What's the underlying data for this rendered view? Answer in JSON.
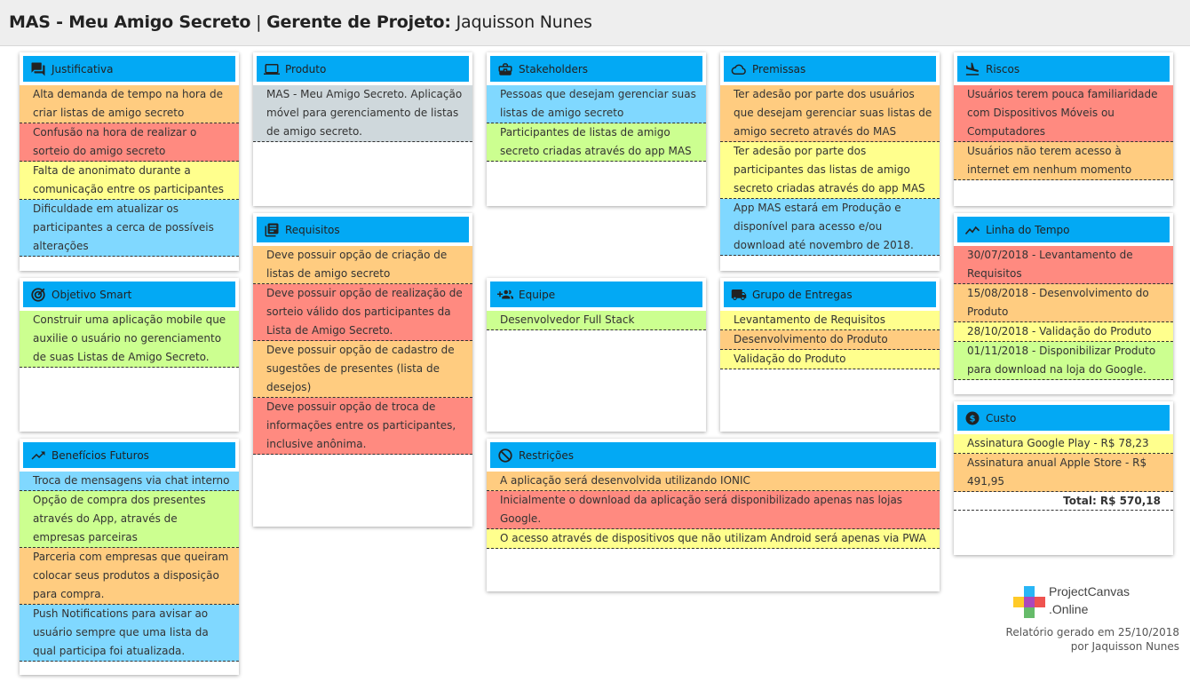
{
  "header": {
    "app_name": "MAS - Meu Amigo Secreto",
    "separator": " | ",
    "pm_label": "Gerente de Projeto:",
    "pm_name": " Jaquisson Nunes"
  },
  "colors": {
    "header_blue": "#03a9f4",
    "orange": "#ffcc80",
    "red": "#ff8a80",
    "yellow": "#ffff8d",
    "blue": "#80d8ff",
    "green": "#ccff90",
    "grey": "#cfd8dc"
  },
  "cards": {
    "justificativa": {
      "title": "Justificativa",
      "icon": "forum-icon",
      "items": [
        "Alta demanda de tempo na hora de criar listas de amigo secreto",
        "Confusão na hora de realizar o sorteio do amigo secreto",
        "Falta de anonimato durante a comunicação entre os participantes",
        "Dificuldade em atualizar os participantes a cerca de possíveis alterações"
      ]
    },
    "produto": {
      "title": "Produto",
      "icon": "laptop-icon",
      "items": [
        "MAS - Meu Amigo Secreto. Aplicação móvel para gerenciamento de listas de amigo secreto."
      ]
    },
    "stakeholders": {
      "title": "Stakeholders",
      "icon": "briefcase-icon",
      "items": [
        "Pessoas que desejam gerenciar suas listas de amigo secreto",
        "Participantes de listas de amigo secreto criadas através do app MAS"
      ]
    },
    "premissas": {
      "title": "Premissas",
      "icon": "cloud-icon",
      "items": [
        "Ter adesão por parte dos usuários que desejam gerenciar suas listas de amigo secreto através do MAS",
        "Ter adesão por parte dos participantes das listas de amigo secreto criadas através do app MAS",
        "App MAS estará em Produção e disponível para acesso e/ou download até novembro de 2018."
      ]
    },
    "riscos": {
      "title": "Riscos",
      "icon": "flight-land-icon",
      "items": [
        "Usuários terem pouca familiaridade com Dispositivos Móveis ou Computadores",
        "Usuários não terem acesso à internet em nenhum momento"
      ]
    },
    "objetivo": {
      "title": "Objetivo Smart",
      "icon": "target-icon",
      "items": [
        "Construir uma aplicação mobile que auxilie o usuário no gerenciamento de suas Listas de Amigo Secreto."
      ]
    },
    "requisitos": {
      "title": "Requisitos",
      "icon": "list-icon",
      "items": [
        "Deve possuir opção de criação de listas de amigo secreto",
        "Deve possuir opção de realização de sorteio válido dos participantes da Lista de Amigo Secreto.",
        "Deve possuir opção de cadastro de sugestões de presentes (lista de desejos)",
        "Deve possuir opção de troca de informações entre os participantes, inclusive anônima."
      ]
    },
    "equipe": {
      "title": "Equipe",
      "icon": "group-add-icon",
      "items": [
        "Desenvolvedor Full Stack"
      ]
    },
    "entregas": {
      "title": "Grupo de Entregas",
      "icon": "truck-icon",
      "items": [
        "Levantamento de Requisitos",
        "Desenvolvimento do Produto",
        "Validação do Produto"
      ]
    },
    "linha": {
      "title": "Linha do Tempo",
      "icon": "timeline-icon",
      "items": [
        "30/07/2018 - Levantamento de Requisitos",
        "15/08/2018 - Desenvolvimento do Produto",
        "28/10/2018 - Validação do Produto",
        "01/11/2018 - Disponibilizar Produto para download na loja do Google."
      ]
    },
    "beneficios": {
      "title": "Benefícios Futuros",
      "icon": "trending-up-icon",
      "items": [
        "Troca de mensagens via chat interno",
        "Opção de compra dos presentes através do App, através de empresas parceiras",
        "Parceria com empresas que queiram colocar seus produtos a disposição para compra.",
        "Push Notifications para avisar ao usuário sempre que uma lista da qual participa foi atualizada."
      ]
    },
    "restricoes": {
      "title": "Restrições",
      "icon": "block-icon",
      "items": [
        "A aplicação será desenvolvida utilizando IONIC",
        "Inicialmente o download da aplicação será disponibilizado apenas nas lojas Google.",
        "O acesso através de dispositivos que não utilizam Android será apenas via PWA"
      ]
    },
    "custo": {
      "title": "Custo",
      "icon": "dollar-icon",
      "items": [
        "Assinatura Google Play - R$ 78,23",
        "Assinatura anual Apple Store - R$ 491,95"
      ],
      "total": "Total: R$ 570,18"
    }
  },
  "footer": {
    "logo_line1": "ProjectCanvas",
    "logo_line2": ".Online",
    "report_line1": "Relatório gerado em 25/10/2018",
    "report_line2": "por Jaquisson Nunes"
  }
}
